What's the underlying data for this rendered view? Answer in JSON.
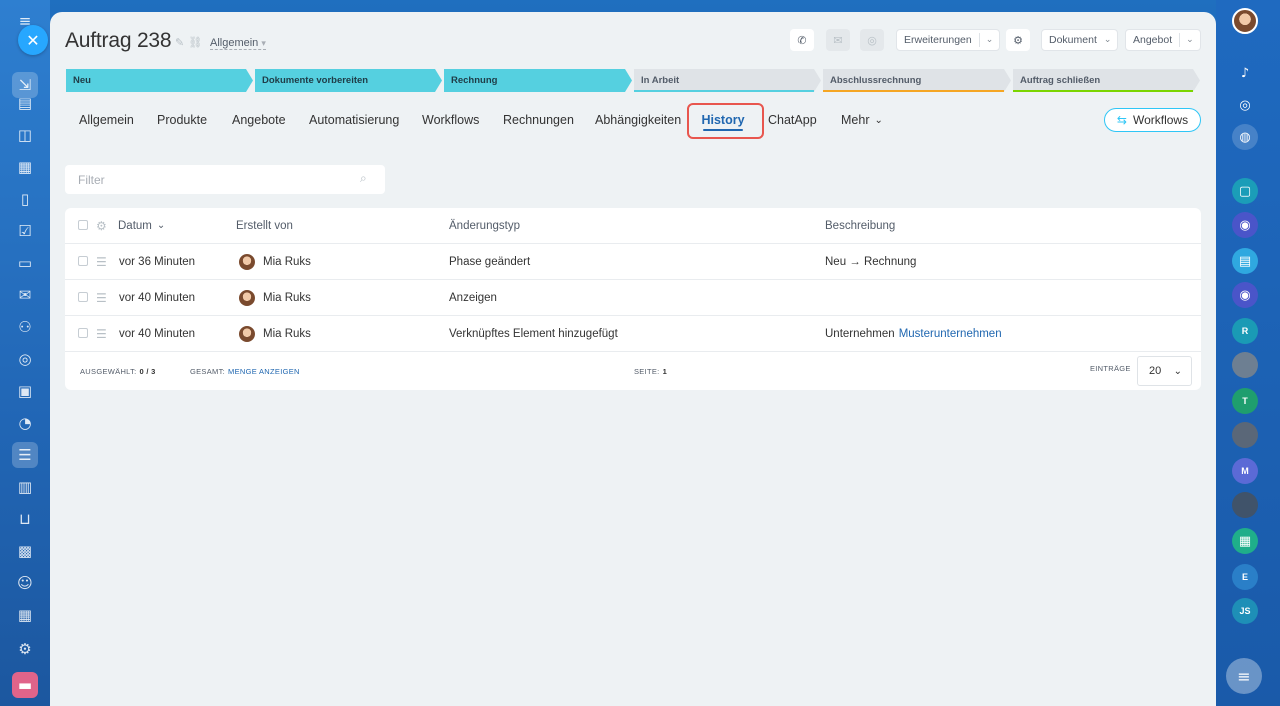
{
  "header": {
    "title": "Auftrag 238",
    "category": "Allgemein",
    "buttons": {
      "erweiterungen": "Erweiterungen",
      "dokument": "Dokument",
      "angebot": "Angebot"
    }
  },
  "pipeline": [
    {
      "label": "Neu",
      "state": "done"
    },
    {
      "label": "Dokumente vorbereiten",
      "state": "done"
    },
    {
      "label": "Rechnung",
      "state": "done"
    },
    {
      "label": "In Arbeit",
      "state": "todo",
      "line_color": "#55d0e0"
    },
    {
      "label": "Abschlussrechnung",
      "state": "todo",
      "line_color": "#f5a623"
    },
    {
      "label": "Auftrag schließen",
      "state": "todo",
      "line_color": "#7bd500"
    }
  ],
  "tabs": [
    {
      "label": "Allgemein"
    },
    {
      "label": "Produkte"
    },
    {
      "label": "Angebote"
    },
    {
      "label": "Automatisierung"
    },
    {
      "label": "Workflows"
    },
    {
      "label": "Rechnungen"
    },
    {
      "label": "Abhängigkeiten"
    },
    {
      "label": "History",
      "active": true
    },
    {
      "label": "ChatApp"
    },
    {
      "label": "Mehr"
    }
  ],
  "workflows_button": "Workflows",
  "filter": {
    "placeholder": "Filter"
  },
  "table": {
    "columns": [
      "Datum",
      "Erstellt von",
      "Änderungstyp",
      "Beschreibung"
    ],
    "rows": [
      {
        "date": "vor 36 Minuten",
        "author": "Mia Ruks",
        "type": "Phase geändert",
        "description": "Neu → Rechnung",
        "link": ""
      },
      {
        "date": "vor 40 Minuten",
        "author": "Mia Ruks",
        "type": "Anzeigen",
        "description": "",
        "link": ""
      },
      {
        "date": "vor 40 Minuten",
        "author": "Mia Ruks",
        "type": "Verknüpftes Element hinzugefügt",
        "description": "Unternehmen",
        "link": "Musterunternehmen"
      }
    ],
    "footer": {
      "selected_label": "Ausgewählt:",
      "selected_value": "0 / 3",
      "total_label": "Gesamt:",
      "total_link": "Menge anzeigen",
      "page_label": "Seite:",
      "page_value": "1",
      "entries_label": "Einträge",
      "entries_value": "20"
    }
  },
  "rail": {
    "right_avatars": [
      "R",
      "T",
      "M",
      "E",
      "JS"
    ]
  },
  "colors": {
    "accent": "#2067b0",
    "stage_done": "#55d0e0",
    "highlight": "#e8564e"
  }
}
